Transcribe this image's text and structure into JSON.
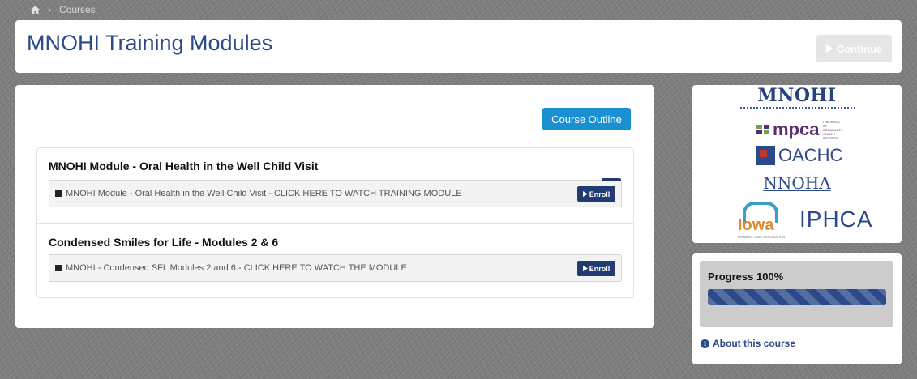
{
  "breadcrumb": {
    "home_icon": "home-icon",
    "separator": "›",
    "current": "Courses"
  },
  "header": {
    "title": "MNOHI Training Modules",
    "continue_label": "Continue",
    "continue_icon": "play-icon"
  },
  "main": {
    "outline_label": "Course Outline",
    "modules": [
      {
        "title": "MNOHI Module - Oral Health in the Well Child Visit",
        "item_icon": "film-icon",
        "item_text": "MNOHI Module - Oral Health in the Well Child Visit - CLICK HERE TO WATCH TRAINING MODULE",
        "enroll_label": "Enroll"
      },
      {
        "title": "Condensed Smiles for Life - Modules 2 & 6",
        "item_icon": "film-icon",
        "item_text": "MNOHI - Condensed SFL Modules 2 and 6 - CLICK HERE TO WATCH THE MODULE",
        "enroll_label": "Enroll"
      }
    ]
  },
  "sidebar": {
    "logos": {
      "mnohi": "MNOHI",
      "mpca": "mpca",
      "mpca_tagline": "THE VOICE OF COMMUNITY HEALTH CENTERS",
      "oachc": "OACHC",
      "nnoha": "NNOHA",
      "iowa": "Iowa",
      "iowa_sub": "PRIMARY CARE ASSOCIATION",
      "iphca": "IPHCA"
    },
    "progress_label": "Progress 100%",
    "progress_value": 1.0,
    "about_label": "About this course",
    "about_icon": "info-icon"
  },
  "colors": {
    "brand_blue": "#2b4a8a",
    "accent_blue": "#1a8fd1",
    "enroll_navy": "#233b73"
  }
}
